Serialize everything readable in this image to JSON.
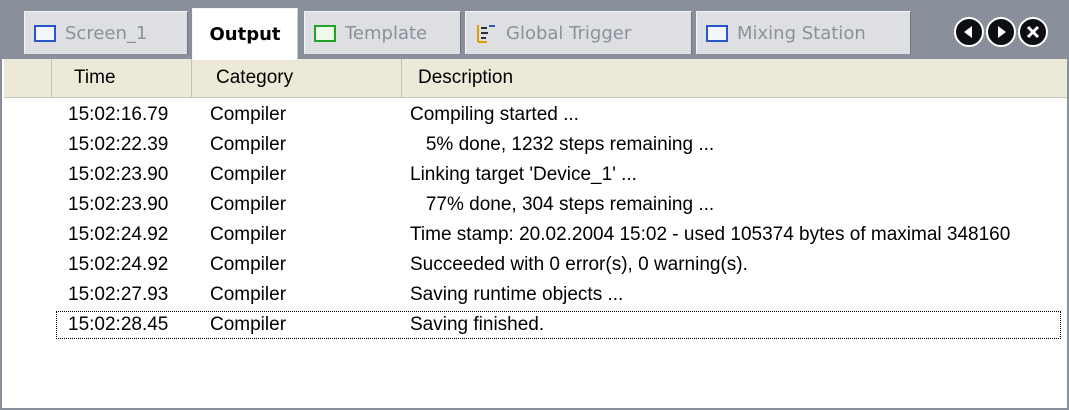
{
  "tabs": [
    {
      "label": "Screen_1",
      "icon": "screen-icon",
      "active": false
    },
    {
      "label": "Output",
      "icon": "",
      "active": true
    },
    {
      "label": "Template",
      "icon": "template-icon",
      "active": false
    },
    {
      "label": "Global Trigger",
      "icon": "trigger-icon",
      "active": false
    },
    {
      "label": "Mixing Station",
      "icon": "screen-icon",
      "active": false
    }
  ],
  "nav_buttons": [
    "previous-tab-icon",
    "next-tab-icon",
    "close-icon"
  ],
  "columns": {
    "time": "Time",
    "category": "Category",
    "description": "Description"
  },
  "rows": [
    {
      "time": "15:02:16.79",
      "category": "Compiler",
      "description": "Compiling started ..."
    },
    {
      "time": "15:02:22.39",
      "category": "Compiler",
      "description": "   5% done, 1232 steps remaining ..."
    },
    {
      "time": "15:02:23.90",
      "category": "Compiler",
      "description": "Linking target 'Device_1' ..."
    },
    {
      "time": "15:02:23.90",
      "category": "Compiler",
      "description": "   77% done, 304 steps remaining ..."
    },
    {
      "time": "15:02:24.92",
      "category": "Compiler",
      "description": "Time stamp: 20.02.2004 15:02 - used 105374 bytes of maximal 348160"
    },
    {
      "time": "15:02:24.92",
      "category": "Compiler",
      "description": "Succeeded with 0 error(s), 0 warning(s)."
    },
    {
      "time": "15:02:27.93",
      "category": "Compiler",
      "description": "Saving runtime objects ..."
    },
    {
      "time": "15:02:28.45",
      "category": "Compiler",
      "description": "Saving finished."
    }
  ],
  "colors": {
    "accent_blue": "#2a55c8",
    "accent_green": "#21a325",
    "tab_bar": "#8a8f9c",
    "header_bg": "#ece9d8"
  }
}
